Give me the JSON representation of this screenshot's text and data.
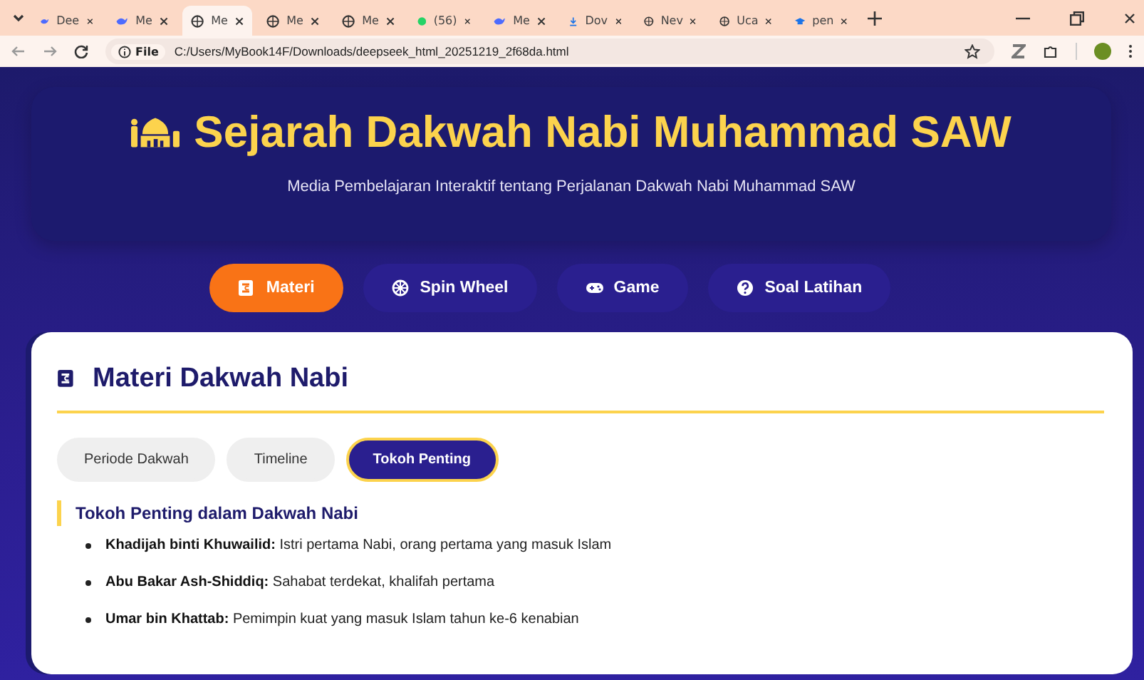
{
  "browser": {
    "tabs": [
      {
        "label": "Dee",
        "selected": false,
        "kind": "ai"
      },
      {
        "label": "Me",
        "selected": false,
        "kind": "ai"
      },
      {
        "label": "Me",
        "selected": true,
        "kind": "globe"
      },
      {
        "label": "Me",
        "selected": false,
        "kind": "globe"
      },
      {
        "label": "Me",
        "selected": false,
        "kind": "globe"
      },
      {
        "label": "(56)",
        "selected": false,
        "kind": "chat"
      },
      {
        "label": "Me",
        "selected": false,
        "kind": "ai"
      },
      {
        "label": "Dov",
        "selected": false,
        "kind": "download"
      },
      {
        "label": "Nev",
        "selected": false,
        "kind": "globe"
      },
      {
        "label": "Uca",
        "selected": false,
        "kind": "globe"
      },
      {
        "label": "pen",
        "selected": false,
        "kind": "hat"
      }
    ],
    "scheme": "File",
    "url": "C:/Users/MyBook14F/Downloads/deepseek_html_20251219_2f68da.html"
  },
  "header": {
    "title": "Sejarah Dakwah Nabi Muhammad SAW",
    "subtitle": "Media Pembelajaran Interaktif tentang Perjalanan Dakwah Nabi Muhammad SAW"
  },
  "nav": [
    {
      "label": "Materi",
      "selected": true,
      "kind": "book"
    },
    {
      "label": "Spin Wheel",
      "selected": false,
      "kind": "wheel"
    },
    {
      "label": "Game",
      "selected": false,
      "kind": "gamepad"
    },
    {
      "label": "Soal Latihan",
      "selected": false,
      "kind": "question"
    }
  ],
  "card": {
    "title": "Materi Dakwah Nabi",
    "subtabs": [
      {
        "label": "Periode Dakwah",
        "selected": false
      },
      {
        "label": "Timeline",
        "selected": false
      },
      {
        "label": "Tokoh Penting",
        "selected": true
      }
    ],
    "section_title": "Tokoh Penting dalam Dakwah Nabi",
    "items": [
      "**Khadijah binti Khuwailid:** Istri pertama Nabi, orang pertama yang masuk Islam",
      "**Abu Bakar Ash-Shiddiq:** Sahabat terdekat, khalifah pertama",
      "**Umar bin Khattab:** Pemimpin kuat yang masuk Islam tahun ke-6 kenabian"
    ]
  }
}
